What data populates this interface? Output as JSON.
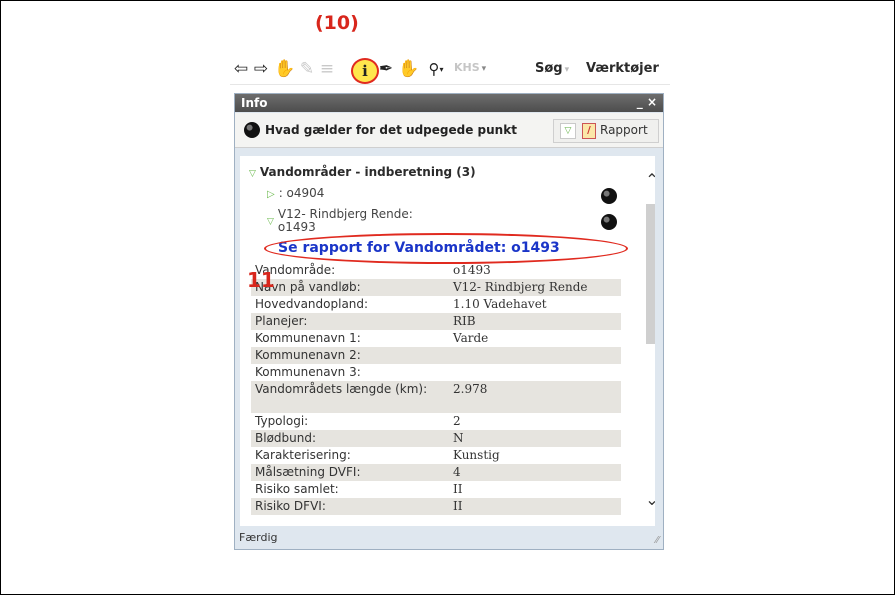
{
  "annotations": {
    "step10": "(10)",
    "step11": "11"
  },
  "toolbar": {
    "icons": [
      {
        "name": "back-arrow-icon",
        "glyph": "⇦"
      },
      {
        "name": "forward-arrow-icon",
        "glyph": "⇨"
      },
      {
        "name": "pan-hand-icon",
        "glyph": "☚"
      },
      {
        "name": "measure-icon",
        "glyph": "✎"
      },
      {
        "name": "list-icon",
        "glyph": "≡"
      },
      {
        "name": "info-tool-icon",
        "glyph": "ℹ"
      },
      {
        "name": "pen-icon",
        "glyph": "✒"
      },
      {
        "name": "hand-select-icon",
        "glyph": "☚"
      },
      {
        "name": "binoculars-icon",
        "glyph": "⚲"
      }
    ],
    "khs_label": "KHS",
    "search_label": "Søg",
    "tools_label": "Værktøjer"
  },
  "panel": {
    "title": "Info",
    "controls": "_ ×",
    "subtitle": "Hvad gælder for det udpegede punkt",
    "report_button": "Rapport",
    "group_title": "Vandområder - indberetning (3)",
    "item1": ": o4904",
    "item2_line1": "V12- Rindbjerg Rende:",
    "item2_line2": "o1493",
    "link_text": "Se rapport for Vandområdet: o1493",
    "attributes": [
      {
        "key": "Vandområde:",
        "value": "o1493"
      },
      {
        "key": "Navn på vandløb:",
        "value": "V12- Rindbjerg Rende"
      },
      {
        "key": "Hovedvandopland:",
        "value": "1.10 Vadehavet"
      },
      {
        "key": "Planejer:",
        "value": "RIB"
      },
      {
        "key": "Kommunenavn 1:",
        "value": "Varde"
      },
      {
        "key": "Kommunenavn 2:",
        "value": ""
      },
      {
        "key": "Kommunenavn 3:",
        "value": ""
      },
      {
        "key": "Vandområdets længde (km):",
        "value": "2.978"
      },
      {
        "key": "Typologi:",
        "value": "2"
      },
      {
        "key": "Blødbund:",
        "value": "N"
      },
      {
        "key": "Karakterisering:",
        "value": "Kunstig"
      },
      {
        "key": "Målsætning DVFI:",
        "value": "4"
      },
      {
        "key": "Risiko samlet:",
        "value": "II"
      },
      {
        "key": "Risiko DFVI:",
        "value": "II"
      }
    ],
    "status": "Færdig"
  },
  "colors": {
    "annotation_red": "#d8261c",
    "link_blue": "#1a35c8",
    "highlight_yellow": "#ffe64d"
  }
}
